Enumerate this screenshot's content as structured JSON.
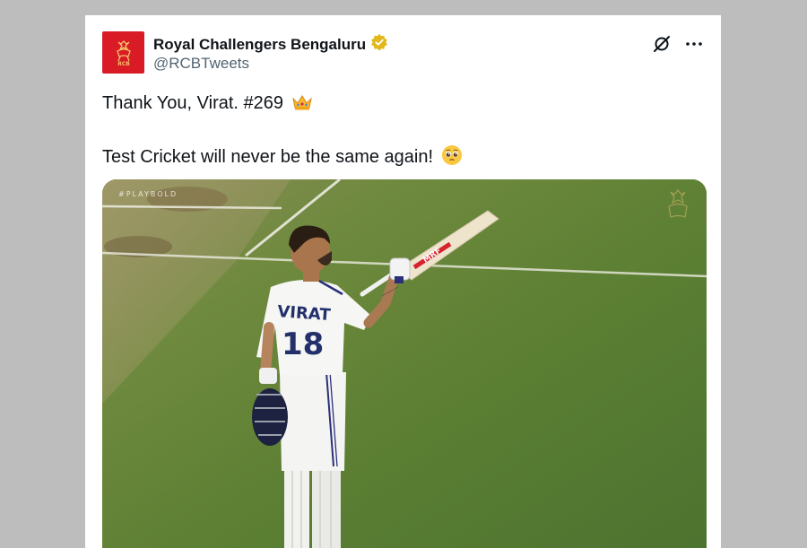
{
  "account": {
    "display_name": "Royal Challengers Bengaluru",
    "handle": "@RCBTweets",
    "avatar_text": "RCB",
    "verified_color": "#e2b719",
    "avatar_color": "#d81b25"
  },
  "tweet": {
    "line1": "Thank You, Virat. #269",
    "line1_emoji": "crown-emoji",
    "line2": "Test Cricket will never be the same again!",
    "line2_emoji": "pleading-face-emoji"
  },
  "media": {
    "watermark": "#PLAYBOLD",
    "jersey_name": "VIRAT",
    "jersey_number": "18",
    "bat_brand": "MRF",
    "pitch_color": "#5d7e35"
  },
  "icons": {
    "grok": "grok-icon",
    "more": "more-icon",
    "verified": "verified-badge-icon"
  }
}
